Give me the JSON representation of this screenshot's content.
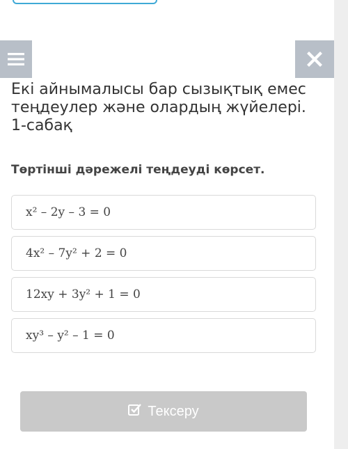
{
  "title": "Екі айнымалысы бар сызықтық емес теңдеулер және олардың жүйелері. 1-сабақ",
  "question": "Төртінші дәрежелі теңдеуді көрсет.",
  "options": [
    "x² – 2y – 3 = 0",
    "4x² – 7y² + 2 = 0",
    "12xy + 3y² + 1 = 0",
    "xy³ – y² – 1 = 0"
  ],
  "check_button": {
    "label": "Тексеру",
    "icon": "check-square-icon"
  },
  "icons": {
    "menu": "hamburger-menu-icon",
    "close": "close-icon"
  },
  "colors": {
    "nav_button_bg": "#b8bfc8",
    "check_button_bg": "#c9c9c9",
    "top_outline": "#3fa9d6"
  }
}
